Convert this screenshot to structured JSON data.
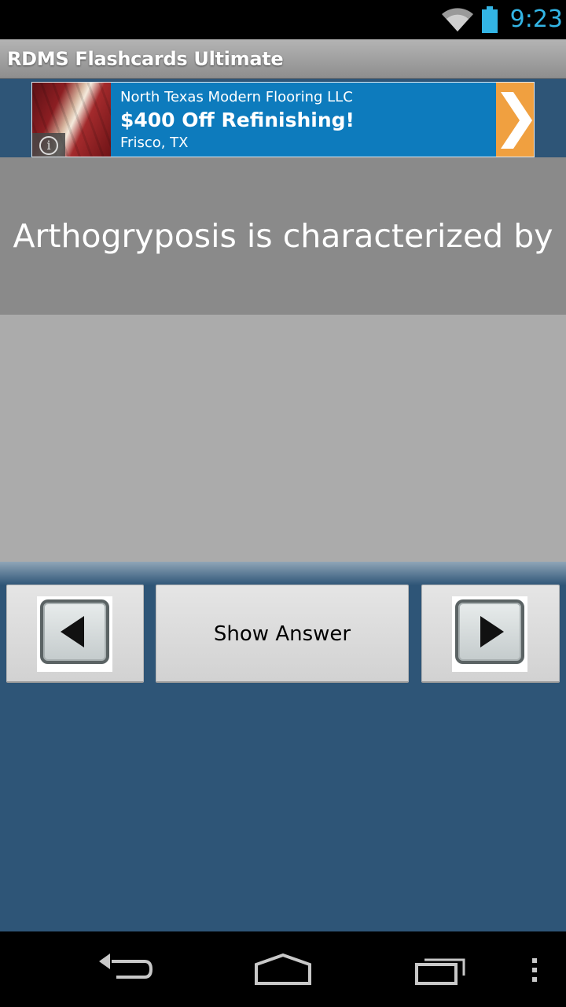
{
  "status_bar": {
    "time": "9:23",
    "icons": [
      "wifi-icon",
      "battery-icon"
    ],
    "accent_color": "#33b5e5"
  },
  "app": {
    "title": "RDMS Flashcards Ultimate"
  },
  "ad": {
    "advertiser": "North Texas Modern Flooring LLC",
    "headline": "$400 Off Refinishing!",
    "location": "Frisco, TX",
    "background_color": "#0d7bbd",
    "arrow_color": "#f0a040"
  },
  "card": {
    "question": "Arthogryposis is characterized by",
    "answer": ""
  },
  "controls": {
    "show_answer_label": "Show Answer",
    "prev_icon": "previous-arrow-icon",
    "next_icon": "next-arrow-icon"
  },
  "nav_bar": {
    "icons": [
      "back-icon",
      "home-icon",
      "recent-apps-icon",
      "menu-icon"
    ]
  },
  "colors": {
    "background": "#2e5577",
    "question_panel": "#8a8a8a",
    "answer_panel": "#ababab"
  }
}
